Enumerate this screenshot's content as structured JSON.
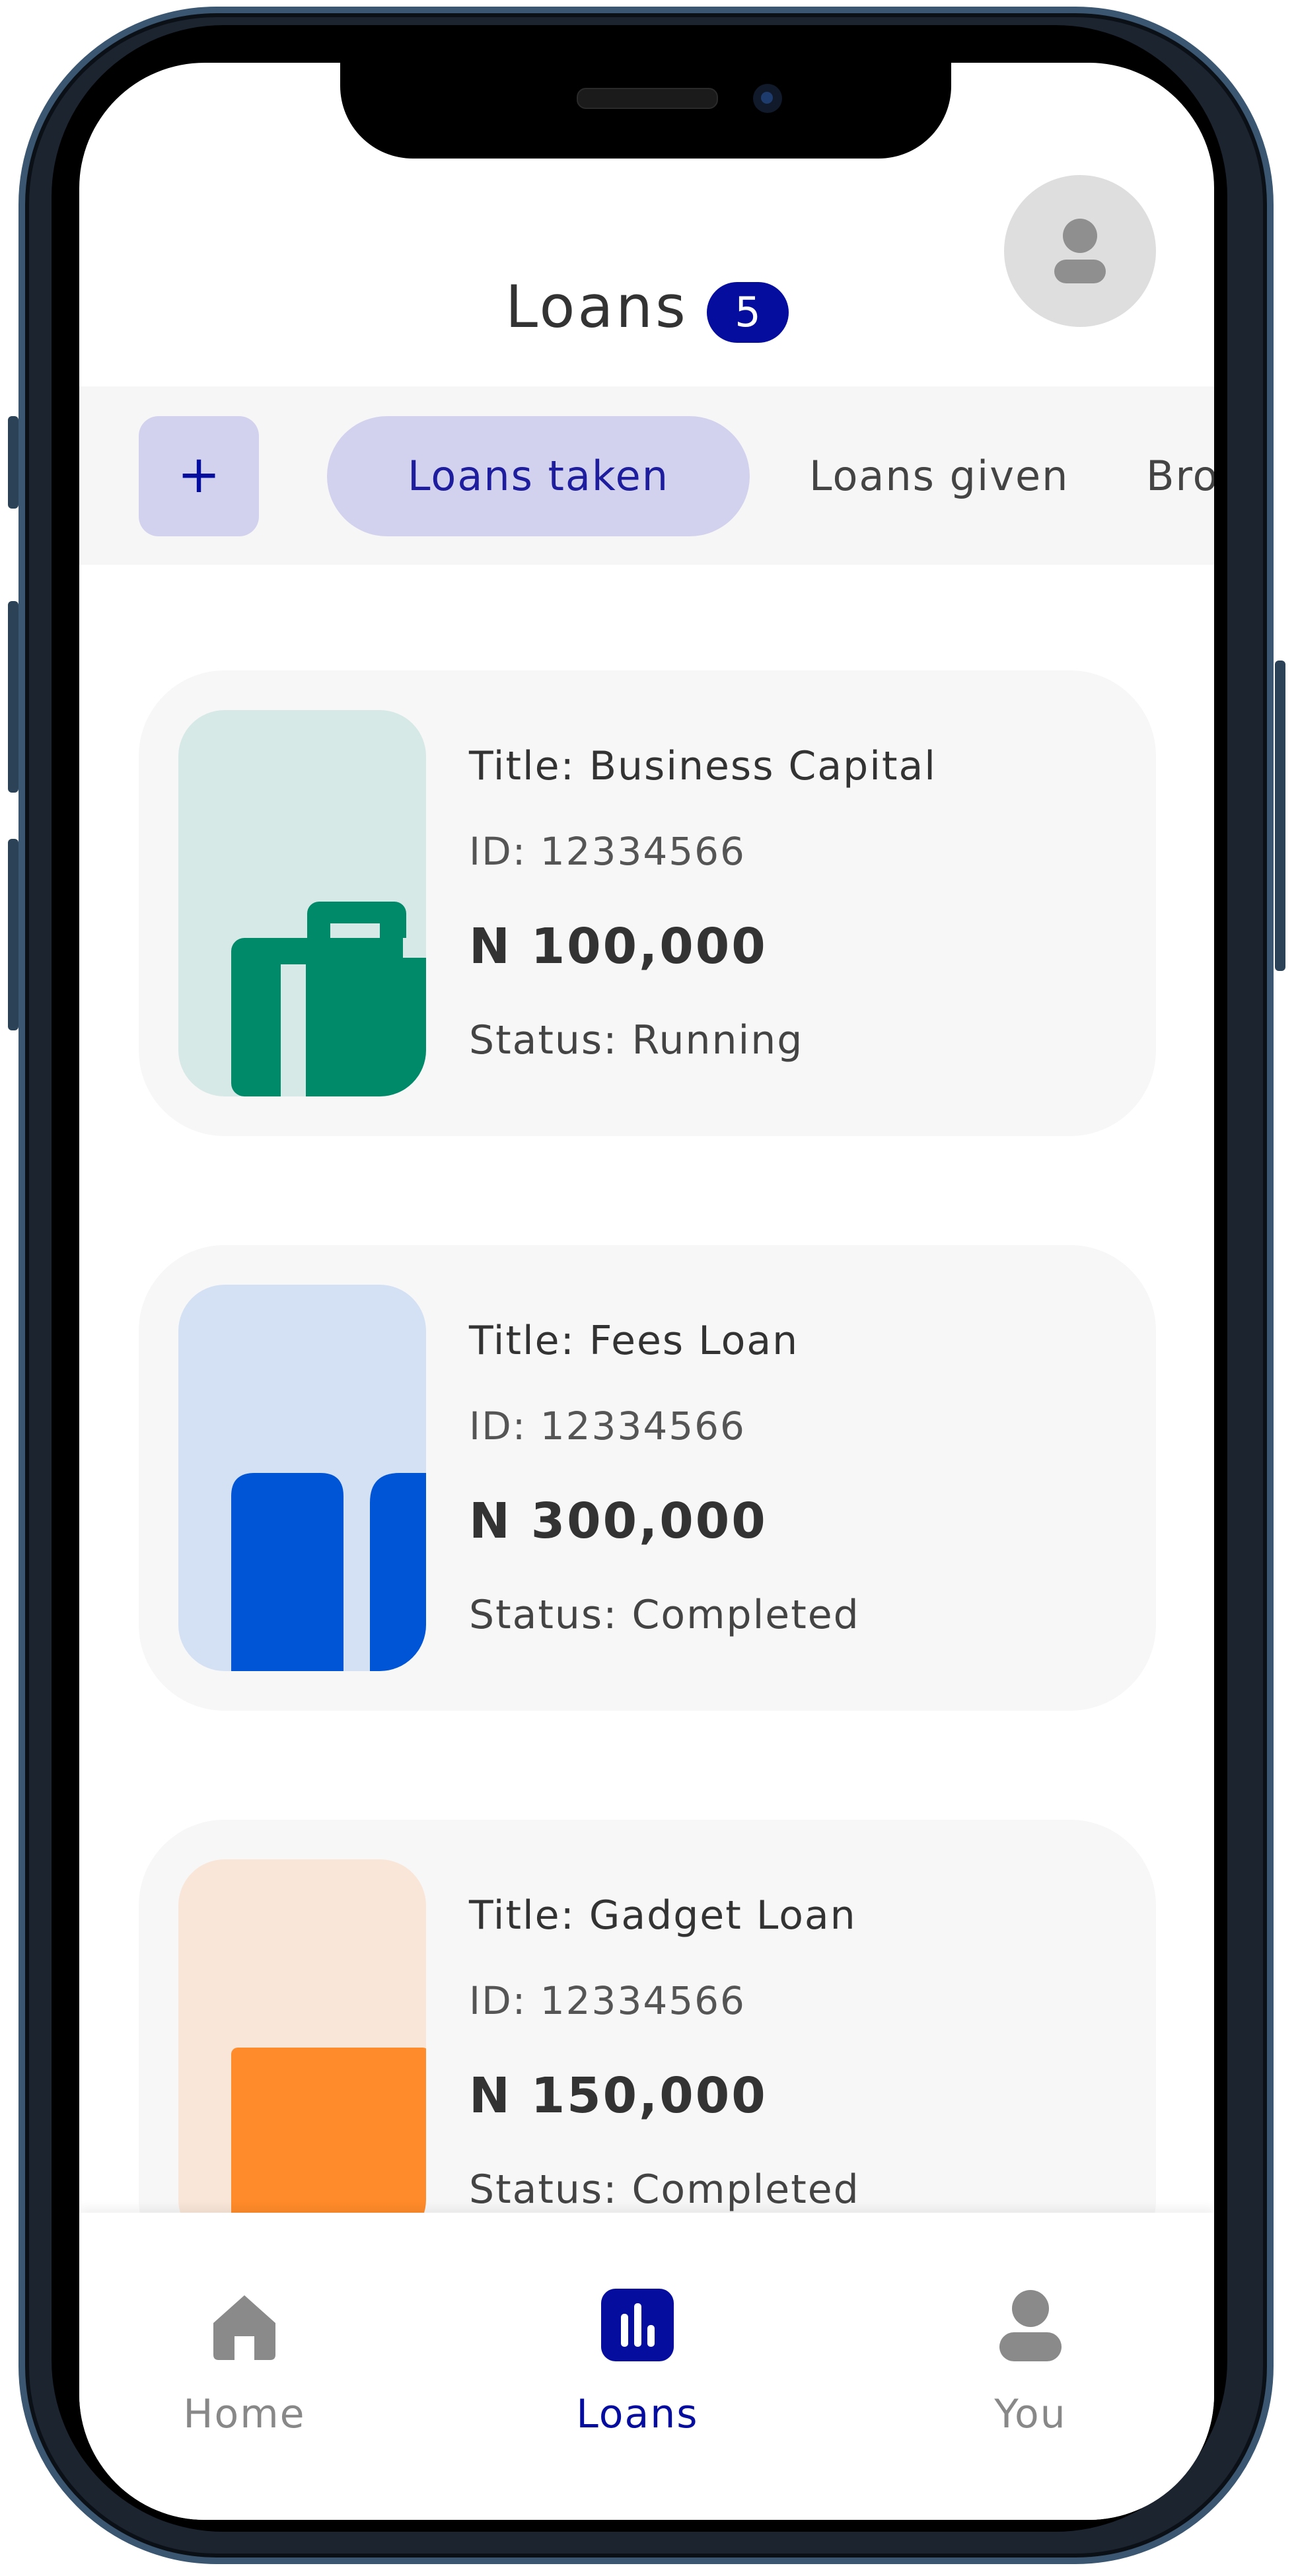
{
  "header": {
    "title": "Loans",
    "count": "5"
  },
  "tabs": {
    "add_label": "+",
    "items": [
      {
        "label": "Loans taken",
        "active": true
      },
      {
        "label": "Loans given",
        "active": false
      },
      {
        "label": "Bro",
        "active": false
      }
    ]
  },
  "loans": [
    {
      "title": "Title: Business Capital",
      "id": "ID: 12334566",
      "amount": "N 100,000",
      "status": "Status: Running",
      "icon": "briefcase-icon",
      "thumb_bg": "#d6e9e6",
      "icon_color": "#008a6a"
    },
    {
      "title": "Title: Fees Loan",
      "id": "ID: 12334566",
      "amount": "N 300,000",
      "status": "Status: Completed",
      "icon": "book-icon",
      "thumb_bg": "#d4e1f4",
      "icon_color": "#0055d6"
    },
    {
      "title": "Title: Gadget Loan",
      "id": "ID: 12334566",
      "amount": "N 150,000",
      "status": "Status: Completed",
      "icon": "gadget-icon",
      "thumb_bg": "#f9e6d8",
      "icon_color": "#ff8b2a"
    }
  ],
  "bottom_nav": [
    {
      "label": "Home",
      "icon": "home-icon",
      "active": false
    },
    {
      "label": "Loans",
      "icon": "chart-icon",
      "active": true
    },
    {
      "label": "You",
      "icon": "person-icon",
      "active": false
    }
  ],
  "colors": {
    "accent": "#050d9e",
    "accent_soft": "#d3d2ee"
  }
}
